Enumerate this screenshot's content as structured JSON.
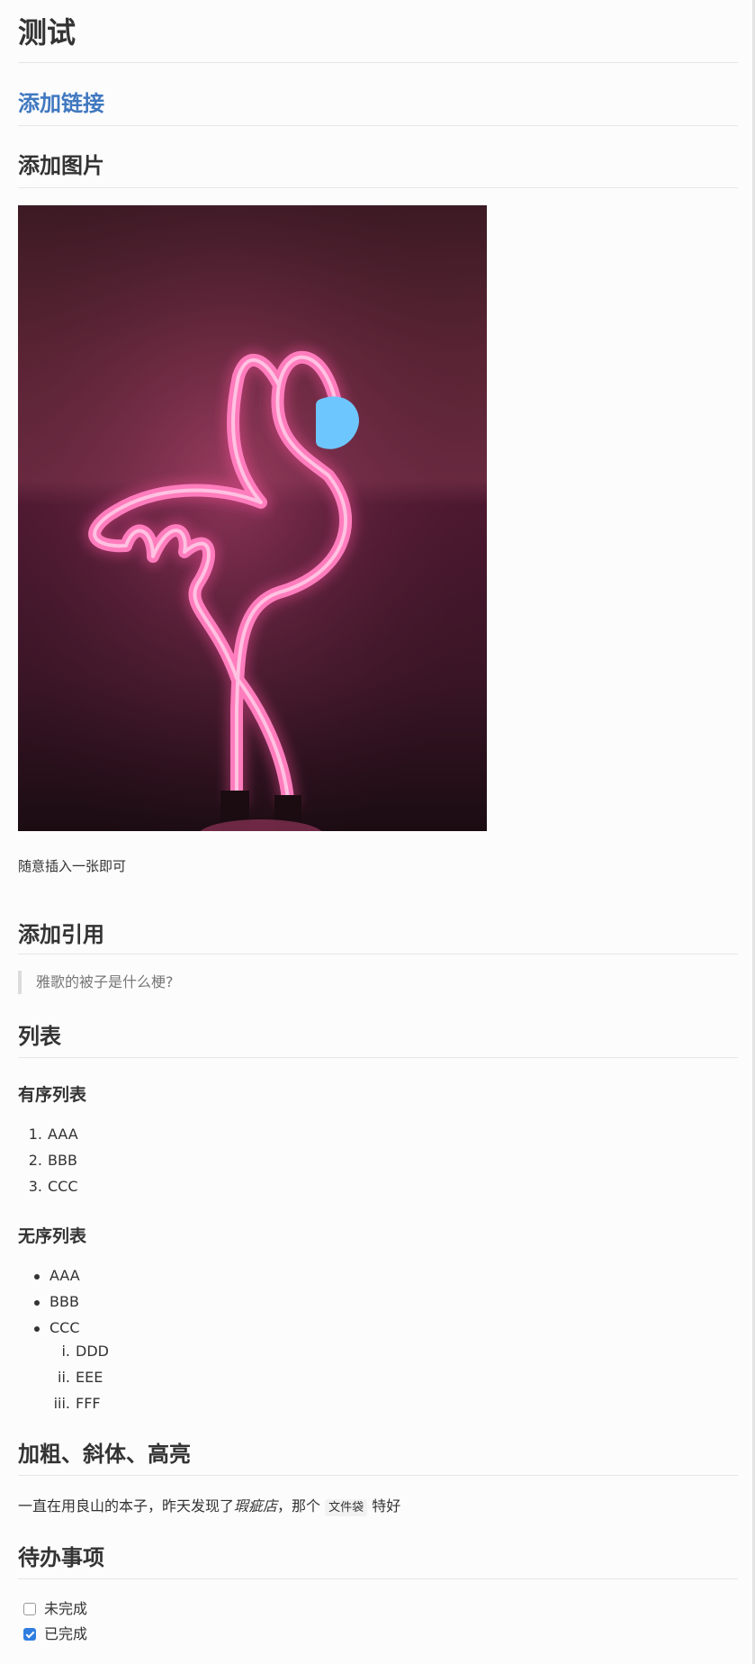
{
  "title": "测试",
  "link_heading": "添加链接",
  "image_heading": "添加图片",
  "image_caption": "随意插入一张即可",
  "quote_heading": "添加引用",
  "quote_text": "雅歌的被子是什么梗?",
  "list_heading": "列表",
  "ordered": {
    "heading": "有序列表",
    "markers": [
      "1.",
      "2.",
      "3."
    ],
    "items": [
      "AAA",
      "BBB",
      "CCC"
    ]
  },
  "unordered": {
    "heading": "无序列表",
    "items": [
      "AAA",
      "BBB",
      "CCC"
    ],
    "sub_markers": [
      "i.",
      "ii.",
      "iii."
    ],
    "sub_items": [
      "DDD",
      "EEE",
      "FFF"
    ]
  },
  "format": {
    "heading": "加粗、斜体、高亮",
    "text_before": "一直在用良山的本子，昨天发现了",
    "italic_text": "瑕疵店",
    "text_middle": "，那个 ",
    "code_text": "文件袋",
    "text_after": " 特好"
  },
  "todo": {
    "heading": "待办事项",
    "items": [
      {
        "label": "未完成",
        "checked": false
      },
      {
        "label": "已完成",
        "checked": true
      }
    ]
  },
  "colors": {
    "link": "#4078c0",
    "neon_pink": "#ff4fa0",
    "neon_blue": "#6ec6ff",
    "checkbox": "#2f7de1"
  }
}
